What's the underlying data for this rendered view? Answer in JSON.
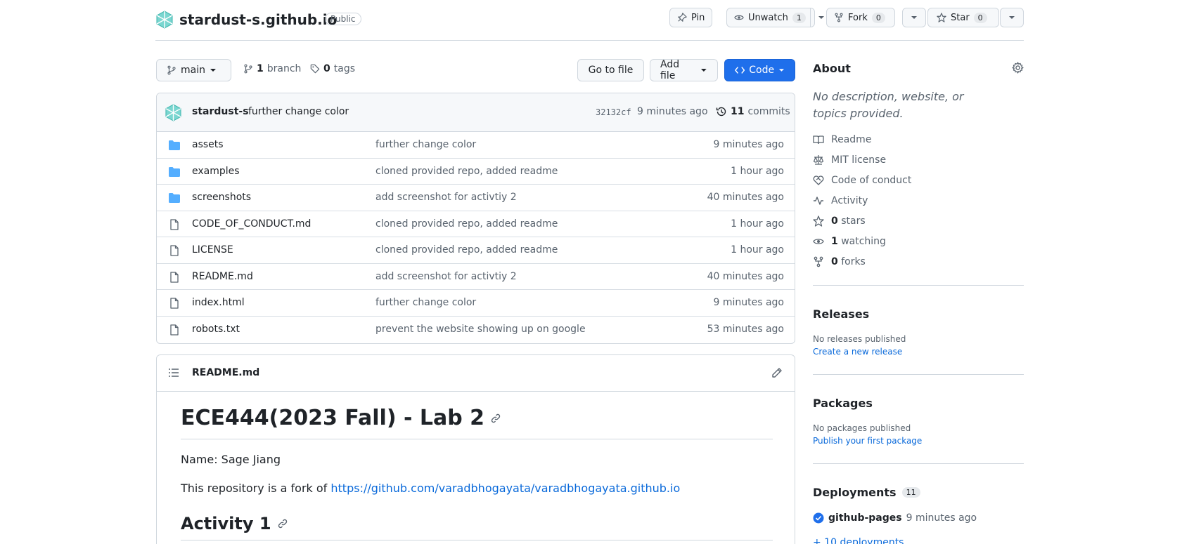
{
  "repo": {
    "name": "stardust-s.github.io",
    "visibility": "Public",
    "pin_label": "Pin",
    "unwatch_label": "Unwatch",
    "watch_count": "1",
    "fork_label": "Fork",
    "fork_count": "0",
    "star_label": "Star",
    "star_count": "0"
  },
  "branch_bar": {
    "branch": "main",
    "branch_count": "1",
    "branch_word": "branch",
    "tag_count": "0",
    "tag_word": "tags",
    "go_to_file": "Go to file",
    "add_file": "Add file",
    "code": "Code"
  },
  "latest_commit": {
    "author": "stardust-s",
    "message": "further change color",
    "hash": "32132cf",
    "age": "9 minutes ago",
    "commit_count": "11",
    "commit_word": "commits"
  },
  "files": [
    {
      "name": "assets",
      "type": "dir",
      "message": "further change color",
      "age": "9 minutes ago"
    },
    {
      "name": "examples",
      "type": "dir",
      "message": "cloned provided repo, added readme",
      "age": "1 hour ago"
    },
    {
      "name": "screenshots",
      "type": "dir",
      "message": "add screenshot for activtiy 2",
      "age": "40 minutes ago"
    },
    {
      "name": "CODE_OF_CONDUCT.md",
      "type": "file",
      "message": "cloned provided repo, added readme",
      "age": "1 hour ago"
    },
    {
      "name": "LICENSE",
      "type": "file",
      "message": "cloned provided repo, added readme",
      "age": "1 hour ago"
    },
    {
      "name": "README.md",
      "type": "file",
      "message": "add screenshot for activtiy 2",
      "age": "40 minutes ago"
    },
    {
      "name": "index.html",
      "type": "file",
      "message": "further change color",
      "age": "9 minutes ago"
    },
    {
      "name": "robots.txt",
      "type": "file",
      "message": "prevent the website showing up on google",
      "age": "53 minutes ago"
    }
  ],
  "readme": {
    "filename": "README.md",
    "h1": "ECE444(2023 Fall) - Lab 2",
    "name_line": "Name: Sage Jiang",
    "fork_prefix": "This repository is a fork of ",
    "fork_link": "https://github.com/varadbhogayata/varadbhogayata.github.io",
    "h2": "Activity 1"
  },
  "about": {
    "title": "About",
    "description": "No description, website, or topics provided.",
    "readme": "Readme",
    "license": "MIT license",
    "conduct": "Code of conduct",
    "activity": "Activity",
    "stars_count": "0",
    "stars_word": "stars",
    "watching_count": "1",
    "watching_word": "watching",
    "forks_count": "0",
    "forks_word": "forks"
  },
  "releases": {
    "title": "Releases",
    "none": "No releases published",
    "create": "Create a new release"
  },
  "packages": {
    "title": "Packages",
    "none": "No packages published",
    "publish": "Publish your first package"
  },
  "deployments": {
    "title": "Deployments",
    "count": "11",
    "env": "github-pages",
    "age": "9 minutes ago",
    "more": "+ 10 deployments"
  },
  "colors": {
    "accent_blue": "#0969da",
    "code_button": "#1f6feb",
    "folder": "#54aeff",
    "success": "#1f6feb",
    "border": "#d0d7de",
    "muted_text": "#59636e"
  }
}
